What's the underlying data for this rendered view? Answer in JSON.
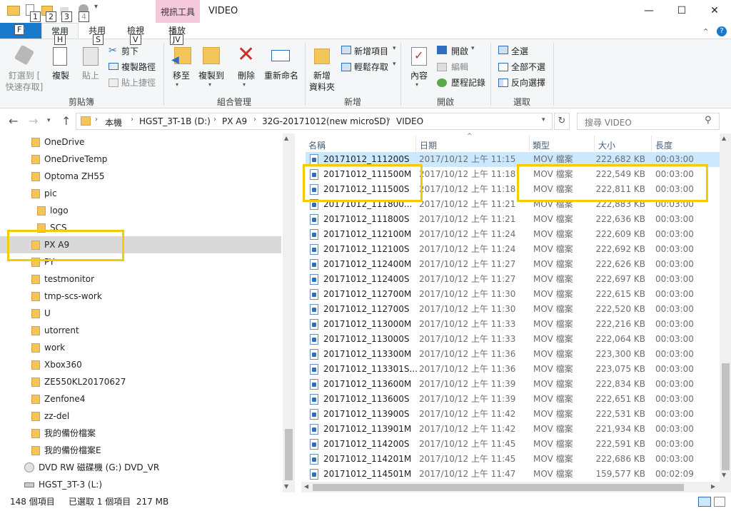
{
  "window": {
    "title": "VIDEO",
    "context_tab_header": "視訊工具",
    "controls": {
      "minimize": "—",
      "maximize": "☐",
      "close": "✕"
    }
  },
  "keytips": {
    "qa1": "1",
    "qa2": "2",
    "qa3": "3",
    "qa4": "4",
    "file": "F",
    "home": "H",
    "share": "S",
    "view": "V",
    "play": "JV"
  },
  "tabs": {
    "file": "檔",
    "home": "常用",
    "share": "共用",
    "view": "檢視",
    "play": "播放"
  },
  "ribbon": {
    "clipboard": {
      "pin": "釘選到 [\n快速存取]",
      "copy": "複製",
      "paste": "貼上",
      "cut": "剪下",
      "copy_path": "複製路徑",
      "paste_shortcut": "貼上捷徑",
      "label": "剪貼簿"
    },
    "organize": {
      "move_to": "移至",
      "copy_to": "複製到",
      "delete": "刪除",
      "rename": "重新命名",
      "label": "組合管理"
    },
    "new": {
      "new_folder": "新增\n資料夾",
      "new_item": "新增項目",
      "easy_access": "輕鬆存取",
      "label": "新增"
    },
    "open": {
      "properties": "內容",
      "open": "開啟",
      "edit": "編輯",
      "history": "歷程記錄",
      "label": "開啟"
    },
    "select": {
      "select_all": "全選",
      "select_none": "全部不選",
      "invert": "反向選擇",
      "label": "選取"
    }
  },
  "address": {
    "path": [
      "本機",
      "HGST_3T-1B (D:)",
      "PX A9",
      "32G-20171012(new microSD)",
      "VIDEO"
    ],
    "search_placeholder": "搜尋 VIDEO"
  },
  "tree": {
    "items": [
      {
        "label": "OneDrive"
      },
      {
        "label": "OneDriveTemp"
      },
      {
        "label": "Optoma ZH55"
      },
      {
        "label": "pic"
      },
      {
        "label": "logo"
      },
      {
        "label": "SCS"
      },
      {
        "label": "PX A9"
      },
      {
        "label": "PY"
      },
      {
        "label": "testmonitor"
      },
      {
        "label": "tmp-scs-work"
      },
      {
        "label": "U"
      },
      {
        "label": "utorrent"
      },
      {
        "label": "work"
      },
      {
        "label": "Xbox360"
      },
      {
        "label": "ZE550KL20170627"
      },
      {
        "label": "Zenfone4"
      },
      {
        "label": "zz-del"
      },
      {
        "label": "我的備份檔案"
      },
      {
        "label": "我的備份檔案E"
      },
      {
        "label": "DVD RW 磁碟機 (G:) DVD_VR"
      },
      {
        "label": "HGST_3T-3 (L:)"
      }
    ]
  },
  "columns": {
    "name": "名稱",
    "date": "日期",
    "type": "類型",
    "size": "大小",
    "length": "長度"
  },
  "files": [
    {
      "name": "20171012_111200S",
      "date": "2017/10/12 上午 11:15",
      "type": "MOV 檔案",
      "size": "222,682 KB",
      "length": "00:03:00"
    },
    {
      "name": "20171012_111500M",
      "date": "2017/10/12 上午 11:18",
      "type": "MOV 檔案",
      "size": "222,549 KB",
      "length": "00:03:00"
    },
    {
      "name": "20171012_111500S",
      "date": "2017/10/12 上午 11:18",
      "type": "MOV 檔案",
      "size": "222,811 KB",
      "length": "00:03:00"
    },
    {
      "name": "20171012_111800...",
      "date": "2017/10/12 上午 11:21",
      "type": "MOV 檔案",
      "size": "222,883 KB",
      "length": "00:03:00"
    },
    {
      "name": "20171012_111800S",
      "date": "2017/10/12 上午 11:21",
      "type": "MOV 檔案",
      "size": "222,636 KB",
      "length": "00:03:00"
    },
    {
      "name": "20171012_112100M",
      "date": "2017/10/12 上午 11:24",
      "type": "MOV 檔案",
      "size": "222,609 KB",
      "length": "00:03:00"
    },
    {
      "name": "20171012_112100S",
      "date": "2017/10/12 上午 11:24",
      "type": "MOV 檔案",
      "size": "222,692 KB",
      "length": "00:03:00"
    },
    {
      "name": "20171012_112400M",
      "date": "2017/10/12 上午 11:27",
      "type": "MOV 檔案",
      "size": "222,626 KB",
      "length": "00:03:00"
    },
    {
      "name": "20171012_112400S",
      "date": "2017/10/12 上午 11:27",
      "type": "MOV 檔案",
      "size": "222,697 KB",
      "length": "00:03:00"
    },
    {
      "name": "20171012_112700M",
      "date": "2017/10/12 上午 11:30",
      "type": "MOV 檔案",
      "size": "222,615 KB",
      "length": "00:03:00"
    },
    {
      "name": "20171012_112700S",
      "date": "2017/10/12 上午 11:30",
      "type": "MOV 檔案",
      "size": "222,520 KB",
      "length": "00:03:00"
    },
    {
      "name": "20171012_113000M",
      "date": "2017/10/12 上午 11:33",
      "type": "MOV 檔案",
      "size": "222,216 KB",
      "length": "00:03:00"
    },
    {
      "name": "20171012_113000S",
      "date": "2017/10/12 上午 11:33",
      "type": "MOV 檔案",
      "size": "222,064 KB",
      "length": "00:03:00"
    },
    {
      "name": "20171012_113300M",
      "date": "2017/10/12 上午 11:36",
      "type": "MOV 檔案",
      "size": "223,300 KB",
      "length": "00:03:00"
    },
    {
      "name": "20171012_113301S...",
      "date": "2017/10/12 上午 11:36",
      "type": "MOV 檔案",
      "size": "223,075 KB",
      "length": "00:03:00"
    },
    {
      "name": "20171012_113600M",
      "date": "2017/10/12 上午 11:39",
      "type": "MOV 檔案",
      "size": "222,834 KB",
      "length": "00:03:00"
    },
    {
      "name": "20171012_113600S",
      "date": "2017/10/12 上午 11:39",
      "type": "MOV 檔案",
      "size": "222,651 KB",
      "length": "00:03:00"
    },
    {
      "name": "20171012_113900S",
      "date": "2017/10/12 上午 11:42",
      "type": "MOV 檔案",
      "size": "222,531 KB",
      "length": "00:03:00"
    },
    {
      "name": "20171012_113901M",
      "date": "2017/10/12 上午 11:42",
      "type": "MOV 檔案",
      "size": "221,934 KB",
      "length": "00:03:00"
    },
    {
      "name": "20171012_114200S",
      "date": "2017/10/12 上午 11:45",
      "type": "MOV 檔案",
      "size": "222,591 KB",
      "length": "00:03:00"
    },
    {
      "name": "20171012_114201M",
      "date": "2017/10/12 上午 11:45",
      "type": "MOV 檔案",
      "size": "222,686 KB",
      "length": "00:03:00"
    },
    {
      "name": "20171012_114501M",
      "date": "2017/10/12 上午 11:47",
      "type": "MOV 檔案",
      "size": "159,577 KB",
      "length": "00:02:09"
    }
  ],
  "status": {
    "count": "148 個項目",
    "selected": "已選取 1 個項目  217 MB"
  },
  "colors": {
    "accent": "#1979ca",
    "highlight": "#f5cc00",
    "selected_row": "#cce8ff",
    "context_tab": "#f6c8dc"
  }
}
